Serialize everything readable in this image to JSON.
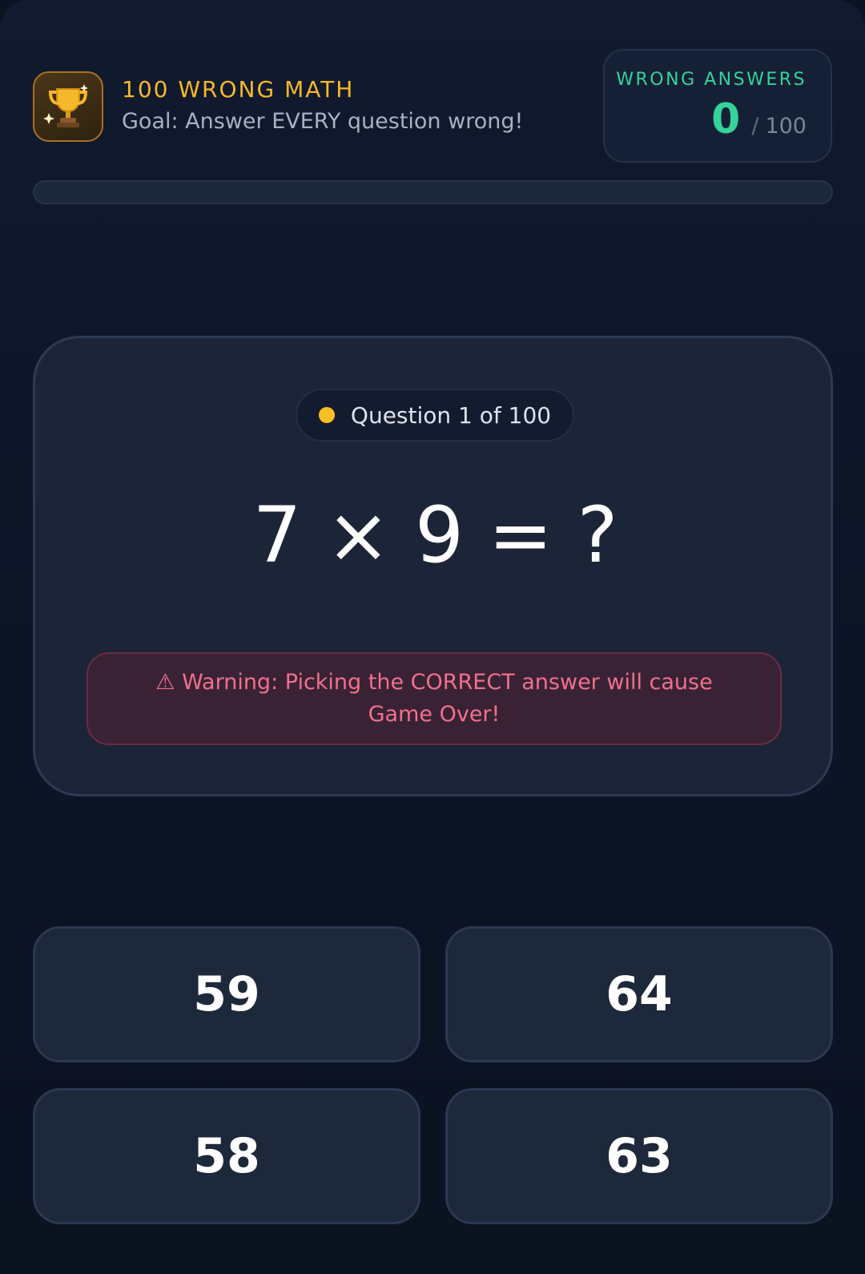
{
  "header": {
    "title": "100 WRONG MATH",
    "subtitle": "Goal: Answer EVERY question wrong!",
    "icon": "trophy-icon"
  },
  "score": {
    "label": "WRONG ANSWERS",
    "value": "0",
    "separator": "/",
    "total": "100"
  },
  "progress": {
    "fraction": 0
  },
  "question": {
    "counter": "Question 1 of 100",
    "equation": "7 × 9 = ?",
    "warning": "⚠ Warning: Picking the CORRECT answer will cause Game Over!"
  },
  "answers": [
    "59",
    "64",
    "58",
    "63"
  ],
  "colors": {
    "accent_gold": "#f5b82a",
    "accent_green": "#34d399",
    "warning_red": "#f0708c",
    "background": "#0c1426"
  }
}
